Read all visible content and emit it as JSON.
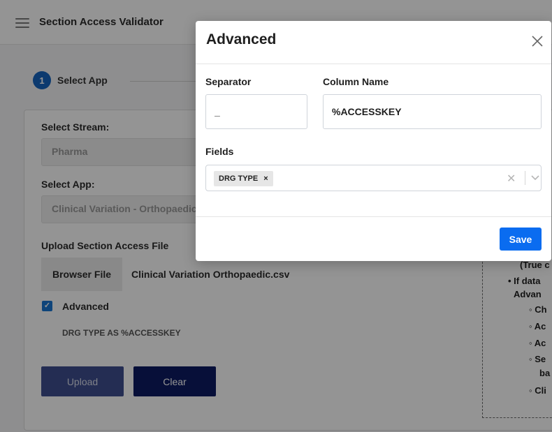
{
  "app": {
    "title": "Section Access Validator",
    "step": {
      "number": "1",
      "label": "Select App"
    },
    "stream_label": "Select Stream:",
    "stream_value": "Pharma",
    "app_label": "Select App:",
    "app_value": "Clinical Variation - Orthopaedic",
    "upload_label": "Upload Section Access File",
    "browse_button": "Browser File",
    "file_name": "Clinical Variation Orthopaedic.csv",
    "advanced_checkbox_label": "Advanced",
    "advanced_summary": "DRG TYPE AS %ACCESSKEY",
    "upload_button": "Upload",
    "clear_button": "Clear",
    "info_lines": [
      "(True c",
      "If data",
      "Advan",
      "Ch",
      "Ac",
      "Ac",
      "Se",
      "ba",
      "Cli"
    ]
  },
  "modal": {
    "title": "Advanced",
    "separator_label": "Separator",
    "separator_value": "_",
    "column_name_label": "Column Name",
    "column_name_value": "%ACCESSKEY",
    "fields_label": "Fields",
    "fields_selected": [
      "DRG TYPE"
    ],
    "save_button": "Save"
  },
  "colors": {
    "primary": "#0a6cf0",
    "step_badge": "#1565c0",
    "upload_btn": "#3f4f8f",
    "clear_btn": "#0d1a63"
  }
}
